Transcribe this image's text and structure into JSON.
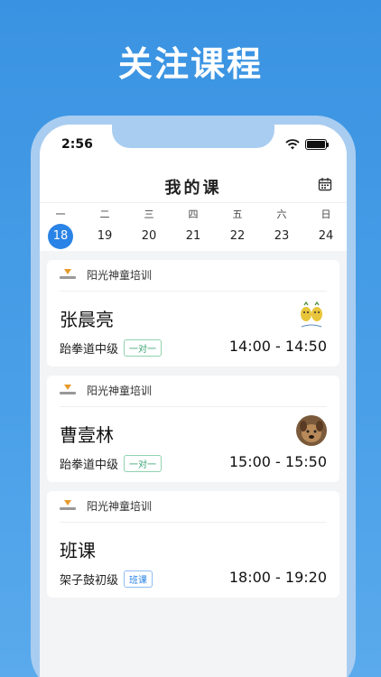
{
  "headline": "关注课程",
  "status": {
    "time": "2:56"
  },
  "app": {
    "title": "我的课"
  },
  "week": [
    {
      "weekday": "一",
      "date": "18",
      "active": true
    },
    {
      "weekday": "二",
      "date": "19",
      "active": false
    },
    {
      "weekday": "三",
      "date": "20",
      "active": false
    },
    {
      "weekday": "四",
      "date": "21",
      "active": false
    },
    {
      "weekday": "五",
      "date": "22",
      "active": false
    },
    {
      "weekday": "六",
      "date": "23",
      "active": false
    },
    {
      "weekday": "日",
      "date": "24",
      "active": false
    }
  ],
  "courses": [
    {
      "org": "阳光神童培训",
      "teacher": "张晨亮",
      "course": "跆拳道中级",
      "tag": "一对一",
      "time": "14:00 - 14:50"
    },
    {
      "org": "阳光神童培训",
      "teacher": "曹壹林",
      "course": "跆拳道中级",
      "tag": "一对一",
      "time": "15:00 - 15:50"
    },
    {
      "org": "阳光神童培训",
      "teacher": "班课",
      "course": "架子鼓初级",
      "tag": "班课",
      "time": "18:00 - 19:20"
    }
  ],
  "colors": {
    "accent": "#2a83e6",
    "background": "#3a93e2",
    "tag_green": "#3aa371"
  }
}
